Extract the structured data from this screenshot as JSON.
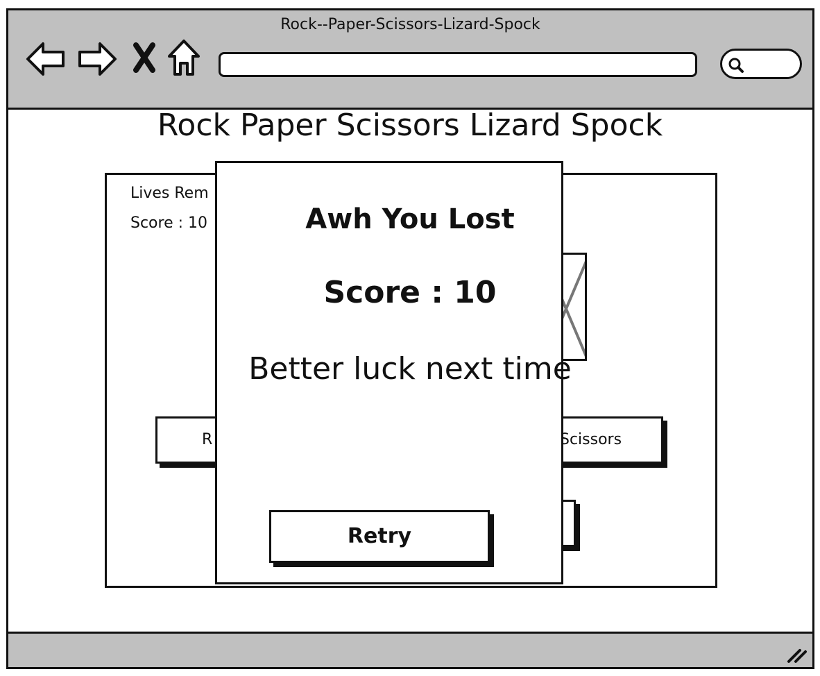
{
  "window": {
    "title": "Rock--Paper-Scissors-Lizard-Spock",
    "address_value": "",
    "nav_icons": [
      "back-arrow-icon",
      "forward-arrow-icon",
      "stop-icon",
      "home-icon"
    ],
    "search_icon": "search-icon"
  },
  "page": {
    "heading": "Rock Paper Scissors Lizard Spock",
    "lives_label": "Lives Rem",
    "score_label": "Score : 10",
    "buttons": {
      "rock_label": "R",
      "scissors_label": "Scissors",
      "partial_label": ""
    }
  },
  "modal": {
    "title": "Awh You Lost",
    "score": "Score : 10",
    "message": "Better luck next time",
    "retry_label": "Retry"
  },
  "colors": {
    "chrome": "#c0c0c0",
    "ink": "#111111",
    "background": "#ffffff"
  }
}
